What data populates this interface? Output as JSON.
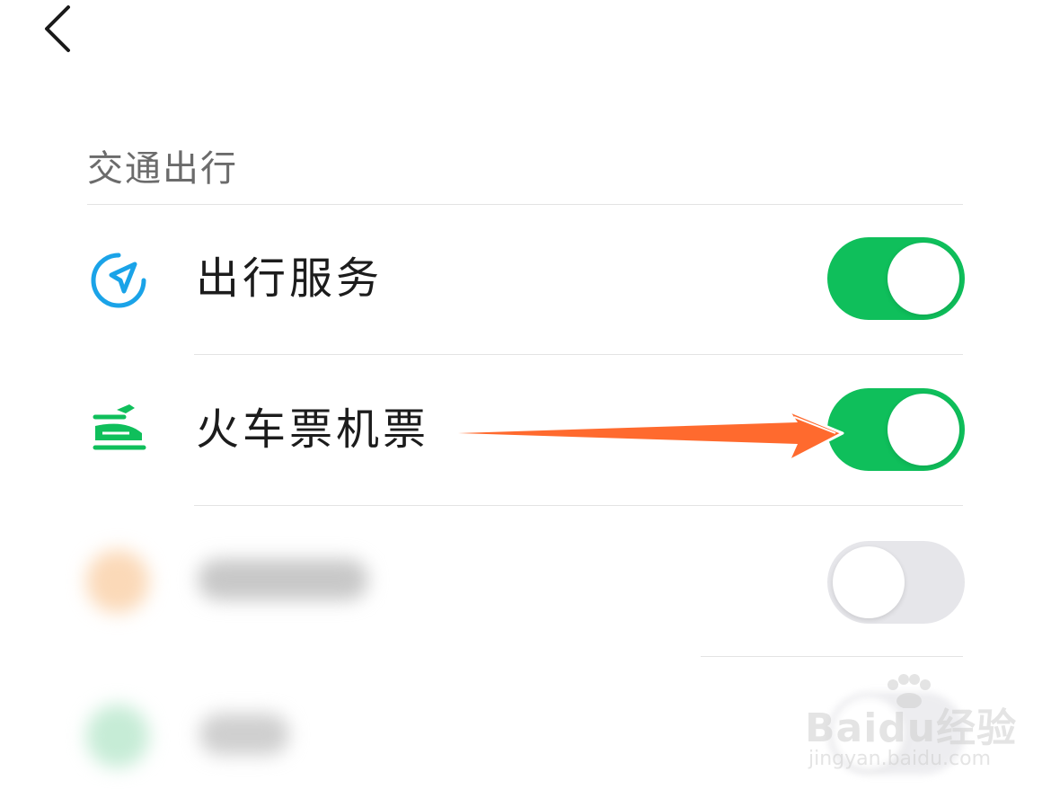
{
  "header": {
    "back_icon": "chevron-left-icon"
  },
  "section": {
    "title": "交通出行"
  },
  "items": [
    {
      "label": "出行服务",
      "icon": "navigation-arrow-icon",
      "icon_color": "#1aa3e8",
      "enabled": true
    },
    {
      "label": "火车票机票",
      "icon": "train-plane-icon",
      "icon_color": "#0fbf5b",
      "enabled": true
    },
    {
      "label": "",
      "icon": "blurred-icon",
      "icon_color": "#fbd3ae",
      "enabled": false
    },
    {
      "label": "",
      "icon": "blurred-icon",
      "icon_color": "#bfe8cf",
      "enabled": false
    }
  ],
  "colors": {
    "toggle_on": "#0fbf5b",
    "toggle_off": "#e6e6ea",
    "annotation_arrow": "#ff6a2e"
  },
  "watermark": {
    "brand": "Baidu经验",
    "url": "jingyan.baidu.com"
  }
}
